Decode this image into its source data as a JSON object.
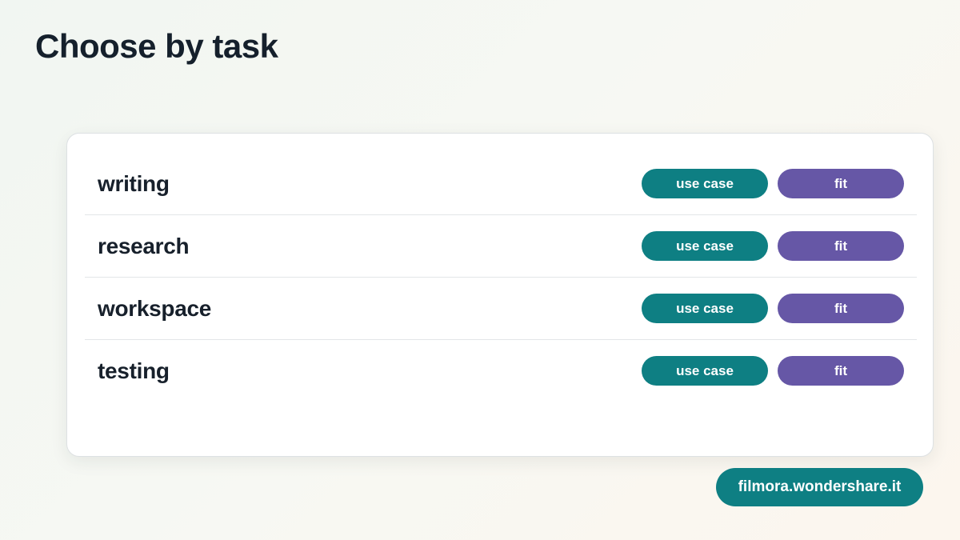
{
  "page": {
    "title": "Choose by task"
  },
  "tasks": [
    {
      "name": "writing",
      "use_case_label": "use case",
      "fit_label": "fit"
    },
    {
      "name": "research",
      "use_case_label": "use case",
      "fit_label": "fit"
    },
    {
      "name": "workspace",
      "use_case_label": "use case",
      "fit_label": "fit"
    },
    {
      "name": "testing",
      "use_case_label": "use case",
      "fit_label": "fit"
    }
  ],
  "badge": {
    "text": "filmora.wondershare.it"
  },
  "colors": {
    "use_case": "#0e7f83",
    "fit": "#6657a6",
    "title": "#15202c"
  }
}
